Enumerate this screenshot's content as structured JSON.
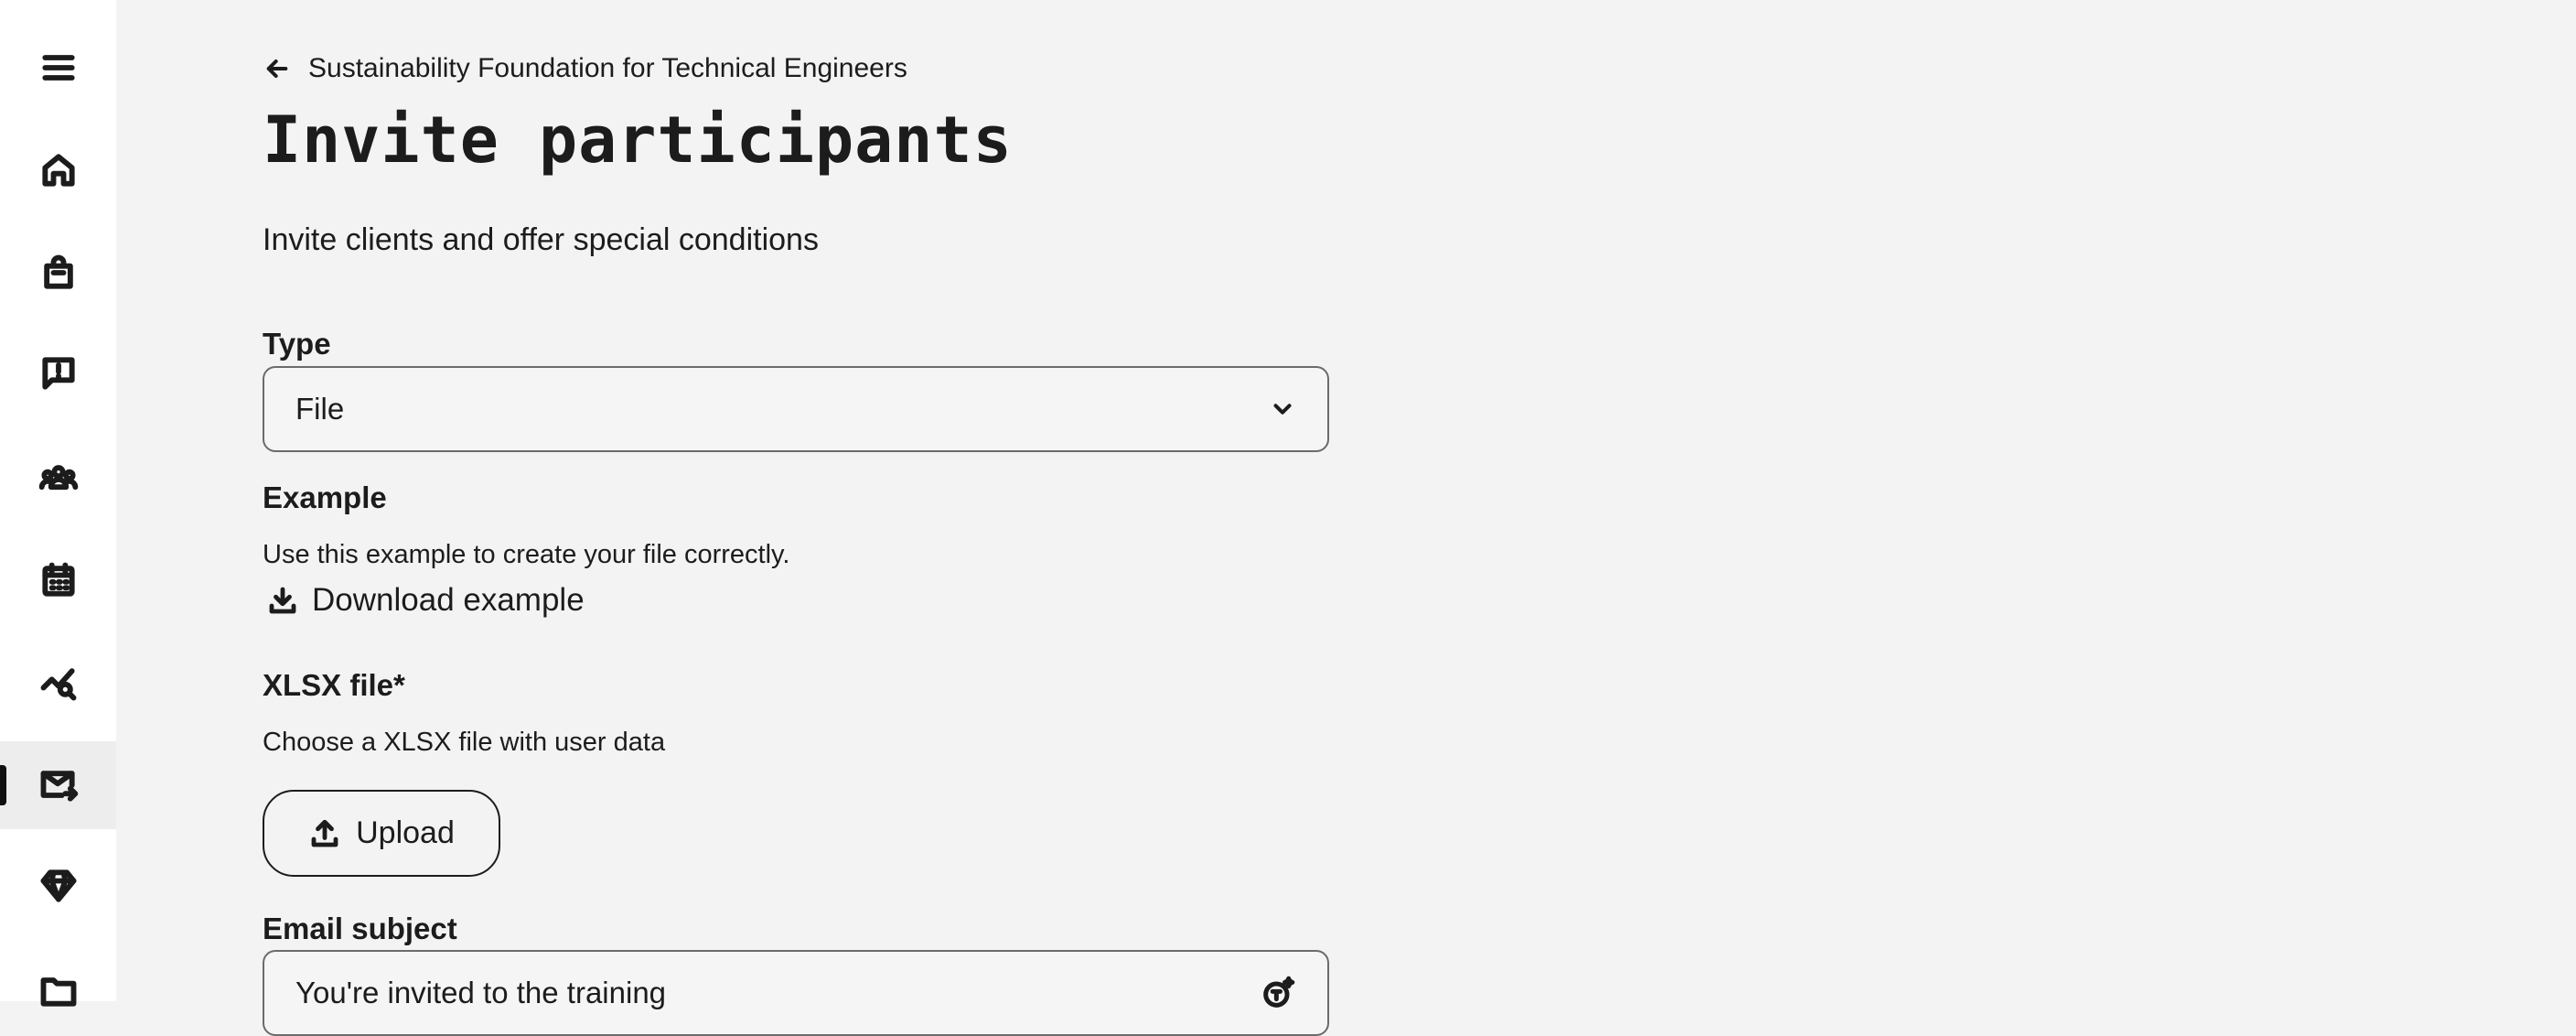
{
  "sidebar": {
    "items": [
      {
        "icon": "menu-icon"
      },
      {
        "icon": "home-icon"
      },
      {
        "icon": "shopping-bag-icon"
      },
      {
        "icon": "feedback-icon"
      },
      {
        "icon": "groups-icon"
      },
      {
        "icon": "calendar-icon"
      },
      {
        "icon": "analytics-icon"
      },
      {
        "icon": "mail-forward-icon",
        "active": true
      },
      {
        "icon": "diamond-icon"
      },
      {
        "icon": "folder-icon"
      }
    ]
  },
  "breadcrumb": {
    "label": "Sustainability Foundation for Technical Engineers",
    "icon": "arrow-left-icon"
  },
  "page": {
    "title": "Invite participants",
    "subtitle": "Invite clients and offer special conditions"
  },
  "form": {
    "type": {
      "label": "Type",
      "value": "File"
    },
    "example": {
      "label": "Example",
      "description": "Use this example to create your file correctly.",
      "download_label": "Download example"
    },
    "xlsx": {
      "label": "XLSX file*",
      "description": "Choose a XLSX file with user data",
      "upload_label": "Upload"
    },
    "email_subject": {
      "label": "Email subject",
      "value": "You're invited to the training"
    }
  }
}
